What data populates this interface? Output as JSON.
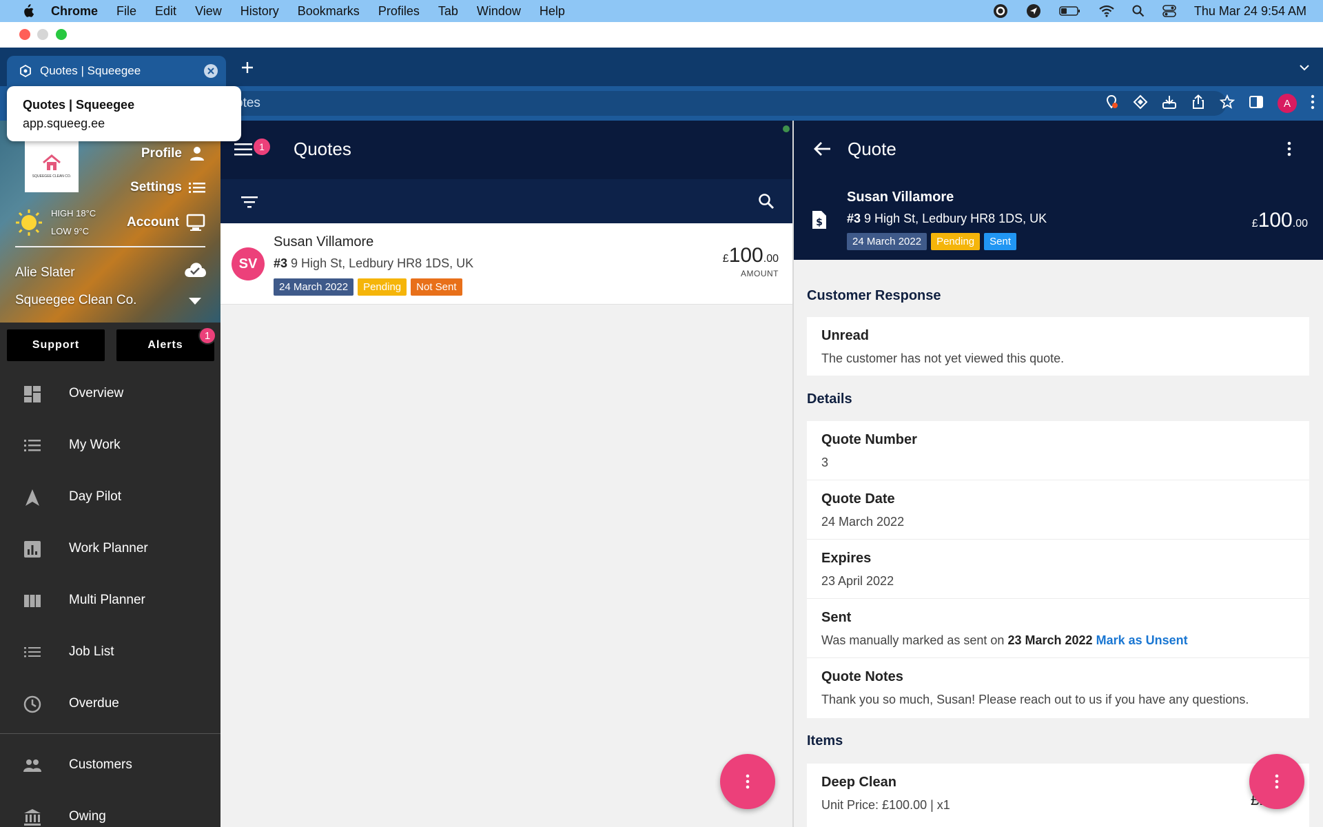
{
  "menubar": {
    "app": "Chrome",
    "items": [
      "File",
      "Edit",
      "View",
      "History",
      "Bookmarks",
      "Profiles",
      "Tab",
      "Window",
      "Help"
    ],
    "clock": "Thu Mar 24  9:54 AM"
  },
  "browser": {
    "tab_title": "Quotes | Squeegee",
    "address_text": "otes",
    "profile_initial": "A",
    "tooltip": {
      "title": "Quotes | Squeegee",
      "url": "app.squeeg.ee"
    }
  },
  "sidebar": {
    "logo_text": "SQUEEGEE CLEAN CO.",
    "links": {
      "profile": "Profile",
      "settings": "Settings",
      "account": "Account"
    },
    "weather": {
      "high": "HIGH 18°C",
      "low": "LOW 9°C"
    },
    "user": "Alie Slater",
    "company": "Squeegee Clean Co.",
    "support": "Support",
    "alerts": "Alerts",
    "alerts_count": "1",
    "nav": [
      {
        "label": "Overview",
        "icon": "dashboard-icon"
      },
      {
        "label": "My Work",
        "icon": "list-icon"
      },
      {
        "label": "Day Pilot",
        "icon": "navigation-arrow-icon"
      },
      {
        "label": "Work Planner",
        "icon": "bar-chart-icon"
      },
      {
        "label": "Multi Planner",
        "icon": "columns-icon"
      },
      {
        "label": "Job List",
        "icon": "list-icon"
      },
      {
        "label": "Overdue",
        "icon": "clock-icon"
      },
      {
        "label": "Customers",
        "icon": "people-icon"
      },
      {
        "label": "Owing",
        "icon": "bank-icon"
      }
    ]
  },
  "quotes": {
    "title": "Quotes",
    "menu_badge": "1",
    "item": {
      "initials": "SV",
      "name": "Susan Villamore",
      "number": "#3",
      "address": "9 High St, Ledbury HR8 1DS, UK",
      "date": "24 March 2022",
      "status": "Pending",
      "sent_status": "Not Sent",
      "currency": "£",
      "amount_whole": "100",
      "amount_dec": ".00",
      "amount_label": "AMOUNT"
    }
  },
  "quote": {
    "title": "Quote",
    "name": "Susan Villamore",
    "number": "#3",
    "address": "9 High St, Ledbury HR8 1DS, UK",
    "date": "24 March 2022",
    "status": "Pending",
    "sent_status": "Sent",
    "currency": "£",
    "amount_whole": "100",
    "amount_dec": ".00",
    "customer_response": {
      "heading": "Customer Response",
      "label": "Unread",
      "value": "The customer has not yet viewed this quote."
    },
    "details": {
      "heading": "Details",
      "quote_number_label": "Quote Number",
      "quote_number": "3",
      "quote_date_label": "Quote Date",
      "quote_date": "24 March 2022",
      "expires_label": "Expires",
      "expires": "23 April 2022",
      "sent_label": "Sent",
      "sent_prefix": "Was manually marked as sent on",
      "sent_date": "23 March 2022",
      "mark_unsent": "Mark as Unsent",
      "notes_label": "Quote Notes",
      "notes": "Thank you so much, Susan! Please reach out to us if you have any questions."
    },
    "items": {
      "heading": "Items",
      "name": "Deep Clean",
      "unit_price": "Unit Price: £100.00 | x1",
      "amount_partial": "£1"
    }
  },
  "colors": {
    "accent_pink": "#ec407a",
    "navy": "#0a1a3c",
    "pending": "#f5b50a",
    "not_sent": "#e8701a",
    "sent": "#2196f3"
  }
}
